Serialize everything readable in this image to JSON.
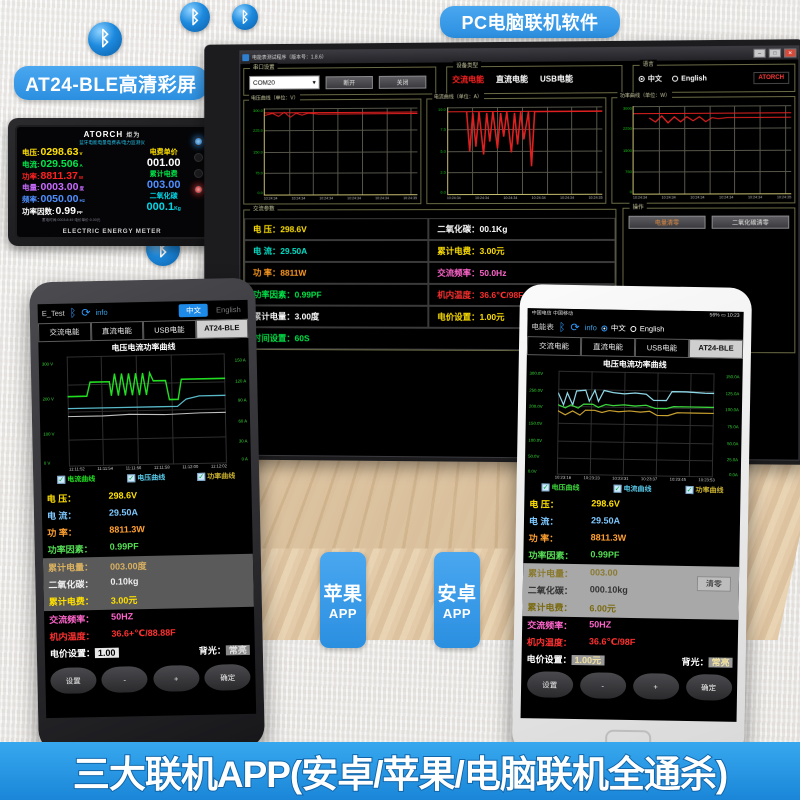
{
  "banners": {
    "device_label": "AT24-BLE高清彩屏",
    "pc_label": "PC电脑联机软件",
    "ios_label_line1": "苹果",
    "ios_label_line2": "APP",
    "android_label_line1": "安卓",
    "android_label_line2": "APP",
    "bottom": "三大联机APP(安卓/苹果/电脑联机全通杀)"
  },
  "meter": {
    "brand": "ATORCH",
    "brand_cn": "炬为",
    "subtitle": "蓝牙电能电量电费表/电力监测仪",
    "footer": "ELECTRIC ENERGY METER",
    "tiny": "蓄电时间:0003:8:49   电价单价:0.00元",
    "rows": [
      {
        "label": "电压:",
        "value": "0298.63",
        "unit": "V",
        "color": "#ffe000"
      },
      {
        "label": "电流:",
        "value": "029.506",
        "unit": "A",
        "color": "#00e84a"
      },
      {
        "label": "功率:",
        "value": "8811.37",
        "unit": "W",
        "color": "#ff2020"
      },
      {
        "label": "电量:",
        "value": "0003.00",
        "unit": "度",
        "color": "#c96bff"
      },
      {
        "label": "频率:",
        "value": "0050.00",
        "unit": "Hz",
        "color": "#4f8fff"
      },
      {
        "label": "功率因数:",
        "value": "0.99",
        "unit": "PF",
        "color": "#ffffff"
      }
    ],
    "right_blocks": [
      {
        "title": "电费单价",
        "value": "001.00",
        "t_color": "#ffe000",
        "v_color": "#ffffff"
      },
      {
        "title": "累计电费",
        "value": "003.00",
        "t_color": "#00e84a",
        "v_color": "#4f8fff"
      },
      {
        "title": "二氧化碳",
        "value": "000.1",
        "unit": "Kg",
        "t_color": "#00d8e8",
        "v_color": "#00d8e8"
      }
    ],
    "leds": [
      "L1",
      "•",
      "M",
      "•"
    ],
    "power_label": "Power"
  },
  "pc": {
    "title": "电能表测试程序（版本号：1.8.6）",
    "window_buttons": [
      "–",
      "□",
      "✕"
    ],
    "serial_group": {
      "label": "串口设置",
      "port_value": "COM20",
      "open_button": "断开",
      "close_button": "关闭"
    },
    "device_group": {
      "label": "设备类型",
      "options": [
        "交流电能",
        "直流电能",
        "USB电能"
      ],
      "selected": "交流电能"
    },
    "language_group": {
      "label": "语言",
      "options": [
        "中文",
        "English"
      ],
      "selected": "中文"
    },
    "logo": "ATORCH",
    "charts": [
      {
        "title": "电压曲线（单位：V）",
        "yticks": [
          "300.0",
          "225.0",
          "150.0",
          "75.0",
          "0.0"
        ],
        "xticks": [
          "10:24:34",
          "10:24:34",
          "10:24:34",
          "10:24:34",
          "10:24:34",
          "10:24:35"
        ],
        "level_pct": 96
      },
      {
        "title": "电流曲线（单位：A）",
        "yticks": [
          "10.0",
          "7.5",
          "5.0",
          "2.5",
          "0.0"
        ],
        "xticks": [
          "10:24:34",
          "10:24:34",
          "10:24:34",
          "10:24:34",
          "10:24:34",
          "10:24:35"
        ],
        "level_pct": 96
      },
      {
        "title": "功率曲线（单位：W）",
        "yticks": [
          "3000",
          "2250",
          "1500",
          "750",
          "0"
        ],
        "xticks": [
          "10:24:34",
          "10:24:34",
          "10:24:34",
          "10:24:34",
          "10:24:34",
          "10:24:35"
        ],
        "level_pct": 90
      }
    ],
    "params_group_label": "交流参数",
    "params": [
      {
        "key": "电  压：",
        "value": "298.6V",
        "color": "#ffe000"
      },
      {
        "key": "二氧化碳：",
        "value": "00.1Kg",
        "color": "#ffffff"
      },
      {
        "key": "电  流：",
        "value": "29.50A",
        "color": "#00e0c8"
      },
      {
        "key": "累计电费：",
        "value": "3.00元",
        "color": "#ffe000"
      },
      {
        "key": "功  率：",
        "value": "8811W",
        "color": "#ff9a20"
      },
      {
        "key": "交流频率：",
        "value": "50.0Hz",
        "color": "#ff66cc"
      },
      {
        "key": "功率因素：",
        "value": "0.99PF",
        "color": "#00e84a"
      },
      {
        "key": "机内温度：",
        "value": "36.6℃/98F",
        "color": "#ff3030"
      },
      {
        "key": "累计电量：",
        "value": "3.00度",
        "color": "#ffffff"
      },
      {
        "key": "电价设置：",
        "value": "1.00元",
        "color": "#ffe000"
      },
      {
        "key": "时间设置：",
        "value": "60S",
        "color": "#00e84a"
      }
    ],
    "right_group_label": "操作",
    "right_buttons": [
      "电量清零",
      "二氧化碳清零"
    ]
  },
  "phone_left": {
    "app_name": "E_Test",
    "icons": [
      "bluetooth-icon",
      "refresh-icon"
    ],
    "info_label": "info",
    "lang_options": [
      "中文",
      "English"
    ],
    "lang_selected": "中文",
    "tabs": [
      "交流电能",
      "直流电能",
      "USB电能",
      "AT24-BLE"
    ],
    "tab_active": "AT24-BLE",
    "chart_title": "电压电流功率曲线",
    "legend": [
      "电流曲线",
      "电压曲线",
      "功率曲线"
    ],
    "rows": [
      {
        "key": "电    压：",
        "value": "298.6V",
        "color": "#ffe000"
      },
      {
        "key": "电    流：",
        "value": "29.50A",
        "color": "#7ec8ff"
      },
      {
        "key": "功    率：",
        "value": "8811.3W",
        "color": "#ffa030"
      },
      {
        "key": "功率因素：",
        "value": "0.99PF",
        "color": "#55dd55"
      },
      {
        "key": "累计电量：",
        "value": "003.00度",
        "color": "#d8b060"
      },
      {
        "key": "二氧化碳：",
        "value": "0.10kg",
        "color": "#dddddd"
      },
      {
        "key": "累计电费：",
        "value": "3.00元",
        "color": "#ffe000"
      },
      {
        "key": "交流频率：",
        "value": "50HZ",
        "color": "#ff66cc"
      },
      {
        "key": "机内温度：",
        "value": "36.6+℃/88.88F",
        "color": "#ff3030"
      }
    ],
    "price_label": "电价设置：",
    "price_value": "1.00",
    "backlight_label": "背光：",
    "backlight_value": "常亮",
    "buttons": [
      "设置",
      "-",
      "+",
      "确定"
    ]
  },
  "phone_right": {
    "status_left": "中国电信 中国移动",
    "status_battery": "56%",
    "status_time": "10:23",
    "app_name": "电能表",
    "info_label": "info",
    "lang_options": [
      "中文",
      "English"
    ],
    "lang_selected": "中文",
    "tabs": [
      "交流电能",
      "直流电能",
      "USB电能",
      "AT24-BLE"
    ],
    "tab_active": "AT24-BLE",
    "chart_title": "电压电流功率曲线",
    "legend": [
      "电压曲线",
      "电流曲线",
      "功率曲线"
    ],
    "clear_button": "清零",
    "rows": [
      {
        "key": "电    压：",
        "value": "298.6V",
        "color": "#ffe000"
      },
      {
        "key": "电    流：",
        "value": "29.50A",
        "color": "#7ec8ff"
      },
      {
        "key": "功    率：",
        "value": "8811.3W",
        "color": "#ffa030"
      },
      {
        "key": "功率因素：",
        "value": "0.99PF",
        "color": "#55dd55"
      },
      {
        "key": "累计电量：",
        "value": "003.00",
        "color": "#d8b060"
      },
      {
        "key": "二氧化碳：",
        "value": "000.10kg",
        "color": "#dddddd"
      },
      {
        "key": "累计电费：",
        "value": "6.00元",
        "color": "#ffe000"
      },
      {
        "key": "交流频率：",
        "value": "50HZ",
        "color": "#ff66cc"
      },
      {
        "key": "机内温度：",
        "value": "36.6℃/98F",
        "color": "#ff3030"
      }
    ],
    "price_label": "电价设置：",
    "price_value": "1.00元",
    "backlight_label": "背光：",
    "backlight_value": "常亮",
    "buttons": [
      "设置",
      "-",
      "+",
      "确定"
    ]
  },
  "chart_data": [
    {
      "type": "line",
      "title": "电压电流功率曲线",
      "chart_of": "phone-right",
      "xlabel": "",
      "ylabel": "V",
      "y2label": "A",
      "ylim": [
        0,
        300
      ],
      "y2lim": [
        0,
        150
      ],
      "yticks": [
        "0.0V",
        "50.0V",
        "100.0V",
        "150.0V",
        "200.0V",
        "250.0V",
        "300.0V"
      ],
      "y2ticks": [
        "0.0A",
        "25.0A",
        "50.0A",
        "75.0A",
        "100.0A",
        "125.0A",
        "150.0A"
      ],
      "x": [
        "10:23:16",
        "10:23:23",
        "10:23:31",
        "10:23:37",
        "10:23:45",
        "10:23:53"
      ],
      "series": [
        {
          "name": "电压曲线",
          "color": "#8fd8e8",
          "values": [
            238,
            205,
            238,
            208,
            245,
            240,
            232,
            235,
            238,
            240,
            236,
            228,
            242,
            240
          ]
        },
        {
          "name": "电流曲线",
          "color": "#3cd43c",
          "values": [
            205,
            198,
            206,
            200,
            208,
            210,
            206,
            207,
            208,
            210,
            206,
            202,
            208,
            208
          ]
        },
        {
          "name": "功率曲线",
          "color": "#c8a030",
          "values": [
            192,
            188,
            193,
            188,
            196,
            197,
            193,
            194,
            195,
            196,
            193,
            189,
            195,
            195
          ]
        }
      ],
      "grid": true,
      "legend_position": "bottom"
    },
    {
      "type": "line",
      "title": "电压电流功率曲线",
      "chart_of": "phone-left",
      "ylim": [
        0,
        300
      ],
      "y2lim": [
        0,
        150
      ],
      "yticks": [
        "0 V",
        "100 V",
        "200 V",
        "300 V"
      ],
      "y2ticks": [
        "0 A",
        "30 A",
        "60 A",
        "90 A",
        "120 A",
        "150 A"
      ],
      "x": [
        "11:11:52",
        "11:11:54",
        "11:11:56",
        "11:11:58",
        "11:12:00",
        "11:12:02",
        "11:12:04"
      ],
      "series": [
        {
          "name": "电流曲线",
          "color": "#22dd22",
          "values": [
            118,
            118,
            150,
            150,
            110,
            165,
            112,
            168,
            110,
            166,
            112,
            165,
            150,
            150,
            112,
            135,
            135
          ]
        },
        {
          "name": "电压曲线",
          "color": "#58b8c8",
          "values": [
            100,
            100,
            100,
            100,
            100,
            100,
            100,
            100,
            100,
            100,
            100,
            100,
            104,
            118,
            122,
            122,
            122
          ]
        },
        {
          "name": "功率曲线",
          "color": "#c0c0c0",
          "values": [
            92,
            92,
            92,
            92,
            93,
            93,
            92,
            93,
            92,
            93,
            92,
            93,
            92,
            93,
            93,
            93,
            93
          ]
        }
      ],
      "grid": true,
      "legend_position": "bottom"
    },
    {
      "type": "line",
      "chart_of": "pc-voltage",
      "title": "电压曲线（单位：V）",
      "ylim": [
        0,
        300
      ],
      "yticks": [
        0,
        75,
        150,
        225,
        300
      ],
      "series": [
        {
          "name": "电压",
          "color": "#e02020",
          "values": [
            288,
            290,
            289,
            291,
            290,
            288,
            290,
            289,
            290,
            290,
            290,
            290
          ]
        }
      ],
      "x": [
        "10:24:34",
        "10:24:34",
        "10:24:34",
        "10:24:34",
        "10:24:34",
        "10:24:35"
      ],
      "grid": true
    },
    {
      "type": "line",
      "chart_of": "pc-current",
      "title": "电流曲线（单位：A）",
      "ylim": [
        0,
        10
      ],
      "yticks": [
        0,
        2.5,
        5,
        7.5,
        10
      ],
      "series": [
        {
          "name": "电流",
          "color": "#e02020",
          "values": [
            9.6,
            9.6,
            7.2,
            9.5,
            6.8,
            9.6,
            7.0,
            9.5,
            6.5,
            9.6,
            9.6,
            9.6
          ]
        }
      ],
      "x": [
        "10:24:34",
        "10:24:34",
        "10:24:34",
        "10:24:34",
        "10:24:34",
        "10:24:35"
      ],
      "grid": true
    },
    {
      "type": "line",
      "chart_of": "pc-power",
      "title": "功率曲线（单位：W）",
      "ylim": [
        0,
        3000
      ],
      "yticks": [
        0,
        750,
        1500,
        2250,
        3000
      ],
      "series": [
        {
          "name": "功率",
          "color": "#e02020",
          "values": [
            2750,
            2760,
            2700,
            2780,
            2720,
            2770,
            2730,
            2760,
            2740,
            2770,
            2760,
            2760
          ]
        }
      ],
      "x": [
        "10:24:34",
        "10:24:34",
        "10:24:34",
        "10:24:34",
        "10:24:34",
        "10:24:35"
      ],
      "grid": true
    }
  ]
}
